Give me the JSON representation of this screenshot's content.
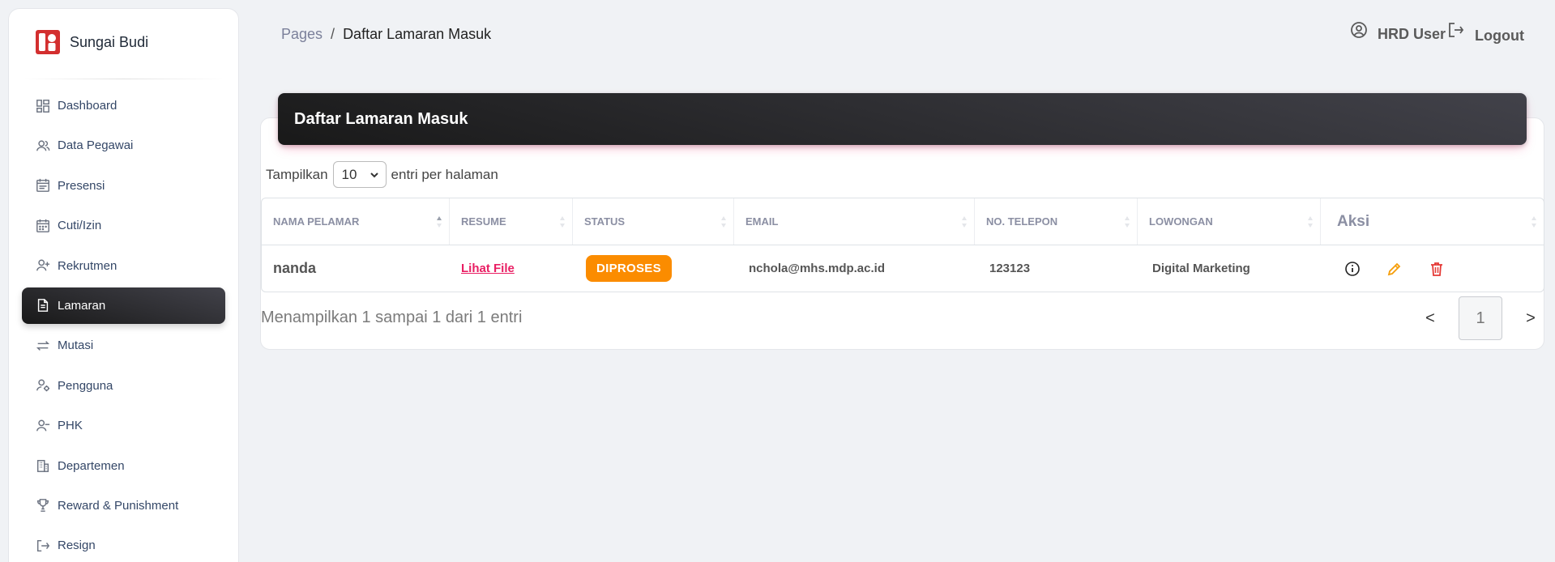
{
  "brand": {
    "name": "Sungai Budi"
  },
  "sidebar": {
    "items": [
      {
        "label": "Dashboard",
        "icon": "dashboard-icon"
      },
      {
        "label": "Data Pegawai",
        "icon": "users-icon"
      },
      {
        "label": "Presensi",
        "icon": "calendar-list-icon"
      },
      {
        "label": "Cuti/Izin",
        "icon": "calendar-icon"
      },
      {
        "label": "Rekrutmen",
        "icon": "user-plus-icon"
      },
      {
        "label": "Lamaran",
        "icon": "document-icon",
        "active": true
      },
      {
        "label": "Mutasi",
        "icon": "transfer-icon"
      },
      {
        "label": "Pengguna",
        "icon": "user-gear-icon"
      },
      {
        "label": "PHK",
        "icon": "user-minus-icon"
      },
      {
        "label": "Departemen",
        "icon": "building-icon"
      },
      {
        "label": "Reward & Punishment",
        "icon": "trophy-icon"
      },
      {
        "label": "Resign",
        "icon": "exit-icon"
      }
    ]
  },
  "header": {
    "breadcrumb": {
      "parent": "Pages",
      "separator": "/",
      "current": "Daftar Lamaran Masuk"
    },
    "user": "HRD User",
    "logout": "Logout"
  },
  "card": {
    "title": "Daftar Lamaran Masuk",
    "entries": {
      "prefix": "Tampilkan",
      "value": "10",
      "suffix": "entri per halaman"
    },
    "columns": [
      "NAMA PELAMAR",
      "RESUME",
      "STATUS",
      "EMAIL",
      "NO. TELEPON",
      "LOWONGAN",
      "Aksi"
    ],
    "rows": [
      {
        "name": "nanda",
        "resume": "Lihat File",
        "status": "DIPROSES",
        "email": "nchola@mhs.mdp.ac.id",
        "phone": "123123",
        "vacancy": "Digital Marketing"
      }
    ],
    "footer": "Menampilkan 1 sampai 1 dari 1 entri",
    "pagination": {
      "prev": "<",
      "page": "1",
      "next": ">"
    }
  },
  "colors": {
    "active_bg": "#191919",
    "status_badge": "#fb8c00",
    "link": "#e91e63",
    "edit_icon": "#f59e0b",
    "delete_icon": "#e53935"
  }
}
